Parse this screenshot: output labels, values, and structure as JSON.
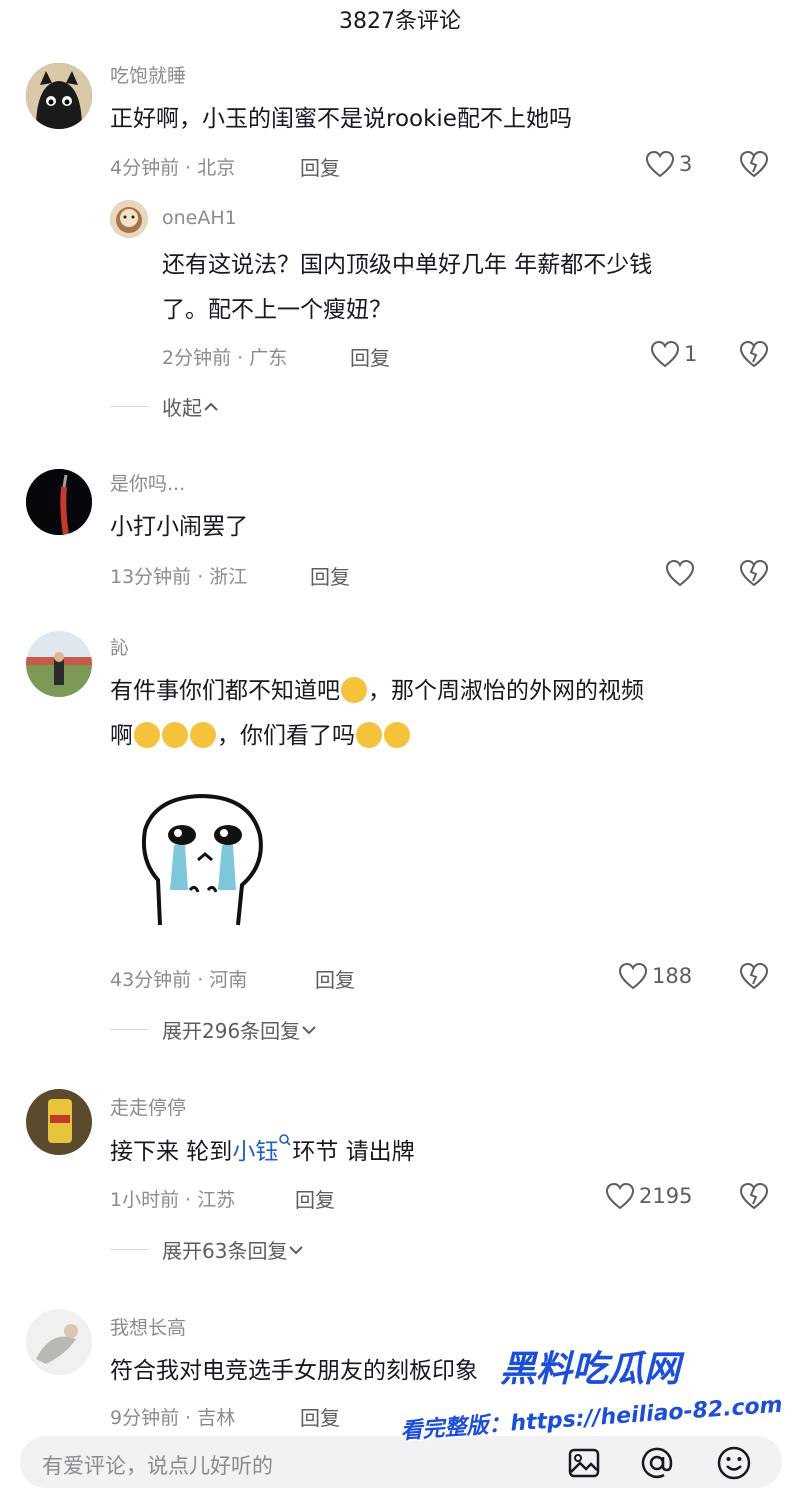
{
  "header": {
    "title": "3827条评论"
  },
  "comments": [
    {
      "user": "吃饱就睡",
      "text": "正好啊，小玉的闺蜜不是说rookie配不上她吗",
      "time_loc": "4分钟前 · 北京",
      "reply_label": "回复",
      "likes": "3",
      "replies": [
        {
          "user": "oneAH1",
          "text_line1": "还有这说法？国内顶级中单好几年 年薪都不少钱",
          "text_line2": "了。配不上一个瘦妞？",
          "time_loc": "2分钟前 · 广东",
          "reply_label": "回复",
          "likes": "1"
        }
      ],
      "collapse_label": "收起"
    },
    {
      "user": "是你吗...",
      "text": "小打小闹罢了",
      "time_loc": "13分钟前 · 浙江",
      "reply_label": "回复",
      "likes": ""
    },
    {
      "user": "訫",
      "text_line1_a": "有件事你们都不知道吧",
      "text_line1_b": "，那个周淑怡的外网的视频",
      "text_line2_a": "啊",
      "text_line2_b": "，你们看了吗",
      "time_loc": "43分钟前 · 河南",
      "reply_label": "回复",
      "likes": "188",
      "expand_label": "展开296条回复"
    },
    {
      "user": "走走停停",
      "text_a": "接下来 轮到",
      "text_link": "小钰",
      "text_b": "环节 请出牌",
      "time_loc": "1小时前 · 江苏",
      "reply_label": "回复",
      "likes": "2195",
      "expand_label": "展开63条回复"
    },
    {
      "user": "我想长高",
      "text": "符合我对电竞选手女朋友的刻板印象",
      "time_loc": "9分钟前 · 吉林",
      "reply_label": "回复"
    }
  ],
  "input": {
    "placeholder": "有爱评论，说点儿好听的"
  },
  "icons": [
    "heart-icon",
    "broken-heart-icon",
    "chevron-up-icon",
    "chevron-down-icon",
    "search-icon",
    "image-icon",
    "at-icon",
    "smile-icon"
  ],
  "watermark": {
    "line1": "黑料吃瓜网",
    "line2": "看完整版：https://heiliao-82.com"
  },
  "colors": {
    "text": "#161823",
    "meta": "#8a8b91",
    "link": "#1f62b8",
    "input_bg": "#f2f2f4"
  }
}
